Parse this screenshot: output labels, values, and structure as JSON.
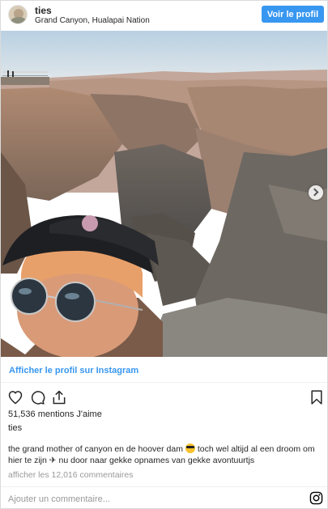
{
  "header": {
    "username": "ties",
    "location": "Grand Canyon, Hualapai Nation",
    "profile_button": "Voir le profil"
  },
  "post": {
    "photo_description_icon": "photo",
    "carousel_next_icon": "chevron-right-icon"
  },
  "profile_link": "Afficher le profil sur Instagram",
  "actions": {
    "like_icon": "heart-icon",
    "comment_icon": "comment-icon",
    "share_icon": "share-icon",
    "save_icon": "bookmark-icon"
  },
  "likes_text": "51,536 mentions J'aime",
  "caption": {
    "username": "ties",
    "text_part1": "the grand mother of canyon en de hoover dam",
    "text_part2": "toch wel altijd al een droom om hier te zijn",
    "text_part3": "nu door naar gekke opnames van gekke avontuurtjs"
  },
  "view_comments": "afficher les 12,016 commentaires",
  "comment_placeholder": "Ajouter un commentaire...",
  "colors": {
    "accent": "#3897f0",
    "text": "#262626",
    "muted": "#999999"
  }
}
